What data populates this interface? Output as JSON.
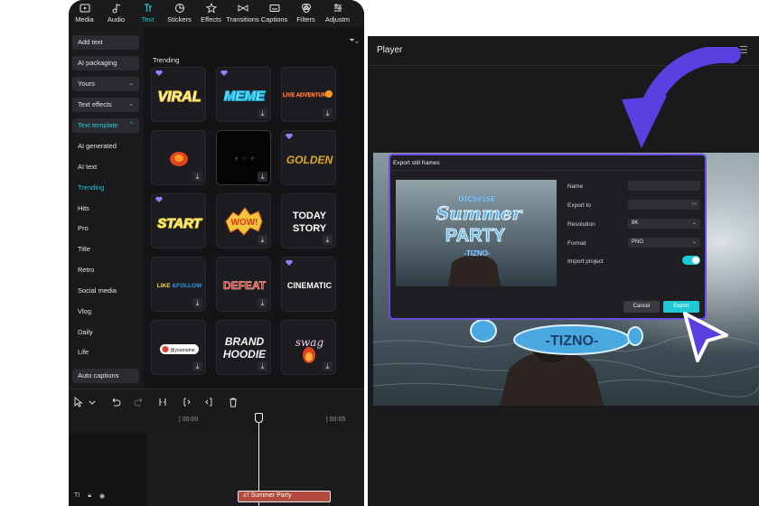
{
  "topbar": {
    "tabs": [
      {
        "label": "Media",
        "icon": "media-icon"
      },
      {
        "label": "Audio",
        "icon": "audio-icon"
      },
      {
        "label": "Text",
        "icon": "text-icon",
        "active": true
      },
      {
        "label": "Stickers",
        "icon": "sticker-icon"
      },
      {
        "label": "Effects",
        "icon": "effects-icon"
      },
      {
        "label": "Transitions",
        "icon": "transitions-icon"
      },
      {
        "label": "Captions",
        "icon": "captions-icon"
      },
      {
        "label": "Filters",
        "icon": "filters-icon"
      },
      {
        "label": "Adjustm",
        "icon": "adjust-icon"
      }
    ]
  },
  "sidebar": {
    "add_text": "Add text",
    "ai_packaging": "AI packaging",
    "yours": "Yours",
    "text_effects": "Text effects",
    "text_template": "Text template",
    "items": [
      "AI generated",
      "AI text",
      "Trending",
      "Hits",
      "Pro",
      "Title",
      "Retro",
      "Social media",
      "Vlog",
      "Daily",
      "Life"
    ],
    "active_item": "Trending",
    "auto_captions": "Auto captions"
  },
  "content": {
    "section_title": "Trending",
    "tiles": [
      "VIRAL",
      "MEME",
      "LIVE ADVENTURE",
      "",
      "",
      "GOLDEN",
      "START",
      "WOW!",
      "TODAY STORY",
      "LIKE & FOLLOW",
      "DEFEAT",
      "CINEMATIC",
      "@yourname",
      "BRAND HOODIE",
      "swag"
    ]
  },
  "timeline": {
    "ruler_start": "| 00:00",
    "ruler_end": "| 00:05",
    "clip_label": "Summer Party"
  },
  "player": {
    "title": "Player"
  },
  "dialog": {
    "title": "Export still frames",
    "name_label": "Name",
    "export_to_label": "Export to",
    "resolution_label": "Resolution",
    "resolution_value": "8K",
    "format_label": "Format",
    "format_value": "PNG",
    "import_label": "Import project",
    "cancel": "Cancel",
    "export": "Export"
  },
  "colors": {
    "accent": "#1fc9d4",
    "dialog_border": "#6b4fe0",
    "arrow": "#5b3fe0"
  }
}
